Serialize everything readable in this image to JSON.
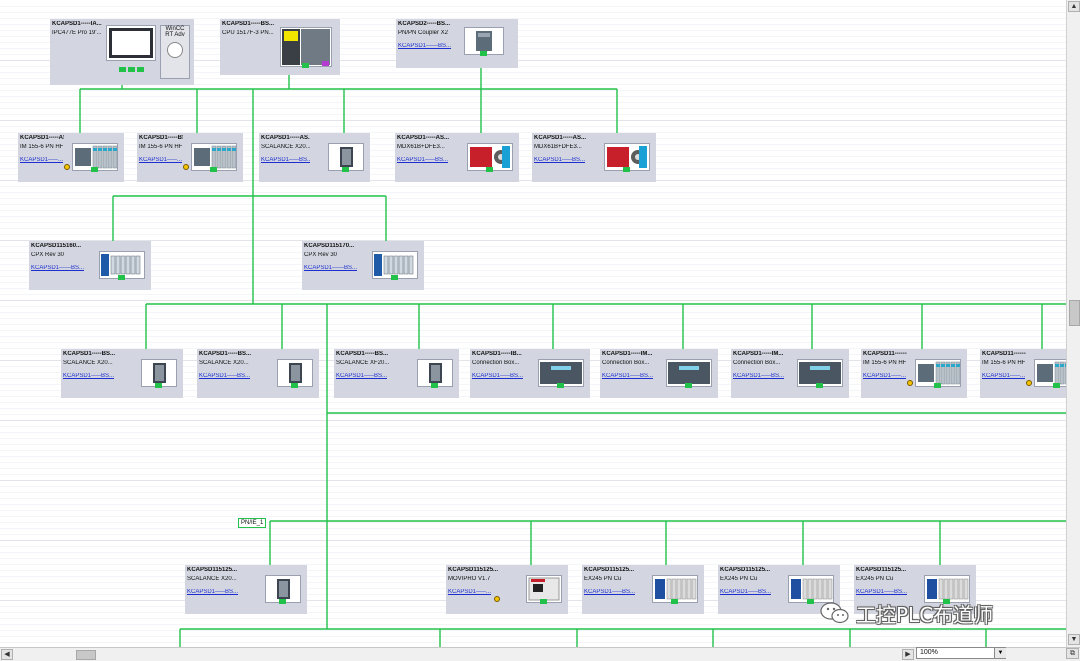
{
  "devices": [
    {
      "name": "KCAPSD1-----IA...",
      "type": "IPC477E Pro 19'...",
      "extra1": "WinCC",
      "extra2": "RT Adv",
      "link": ""
    },
    {
      "name": "KCAPSD1-----BS...",
      "type": "CPU 1517F-3 PN...",
      "link": ""
    },
    {
      "name": "KCAPSD2-----BS...",
      "type": "PN/PN Coupler X2",
      "link": "KCAPSD1------BS..."
    },
    {
      "name": "KCAPSD1-----AS...",
      "type": "IM 155-6 PN HF",
      "link": "KCAPSD1-----..."
    },
    {
      "name": "KCAPSD1-----BS...",
      "type": "IM 155-6 PN HF",
      "link": "KCAPSD1-----..."
    },
    {
      "name": "KCAPSD1-----AS...",
      "type": "SCALANCE X20...",
      "link": "KCAPSD1-----BS..."
    },
    {
      "name": "KCAPSD1-----AS...",
      "type": "MDX61B+DFE3...",
      "link": "KCAPSD1-----BS..."
    },
    {
      "name": "KCAPSD1-----AS...",
      "type": "MDX61B+DFE3...",
      "link": "KCAPSD1-----BS..."
    },
    {
      "name": "KCAPSD115160...",
      "type": "CPX Rev 30",
      "link": "KCAPSD1------BS..."
    },
    {
      "name": "KCAPSD115170...",
      "type": "CPX Rev 30",
      "link": "KCAPSD1------BS..."
    },
    {
      "name": "KCAPSD1-----BS...",
      "type": "SCALANCE X20...",
      "link": "KCAPSD1-----BS..."
    },
    {
      "name": "KCAPSD1-----BS...",
      "type": "SCALANCE X20...",
      "link": "KCAPSD1-----BS..."
    },
    {
      "name": "KCAPSD1-----BS...",
      "type": "SCALANCE XF20...",
      "link": "KCAPSD1-----BS..."
    },
    {
      "name": "KCAPSD1-----IB...",
      "type": "Connection Box...",
      "link": "KCAPSD1-----BS..."
    },
    {
      "name": "KCAPSD1-----IM...",
      "type": "Connection Box...",
      "link": "KCAPSD1-----BS..."
    },
    {
      "name": "KCAPSD1-----IM...",
      "type": "Connection Box...",
      "link": "KCAPSD1-----BS..."
    },
    {
      "name": "KCAPSD11--------...",
      "type": "IM 155-6 PN HF",
      "link": "KCAPSD1-----..."
    },
    {
      "name": "KCAPSD11--------...",
      "type": "IM 155-6 PN HF",
      "link": "KCAPSD1-----..."
    },
    {
      "name": "KCAPSD115125...",
      "type": "SCALANCE X20...",
      "link": "KCAPSD1-----BS..."
    },
    {
      "name": "KCAPSD115125...",
      "type": "MOVIPRO V1.7",
      "link": "KCAPSD1-----..."
    },
    {
      "name": "KCAPSD115125...",
      "type": "EX245 PN Cu",
      "link": "KCAPSD1-----BS..."
    },
    {
      "name": "KCAPSD115125...",
      "type": "EX245 PN Cu",
      "link": "KCAPSD1-----BS..."
    },
    {
      "name": "KCAPSD115125...",
      "type": "EX245 PN Cu",
      "link": "KCAPSD1-----BS..."
    }
  ],
  "network_label": "PN/IE_1",
  "zoom": "100%",
  "watermark": "工控PLC布道师",
  "colors": {
    "network_line": "#22c24a",
    "device_bg": "#d3d6e0",
    "link": "#1d2fd0"
  }
}
